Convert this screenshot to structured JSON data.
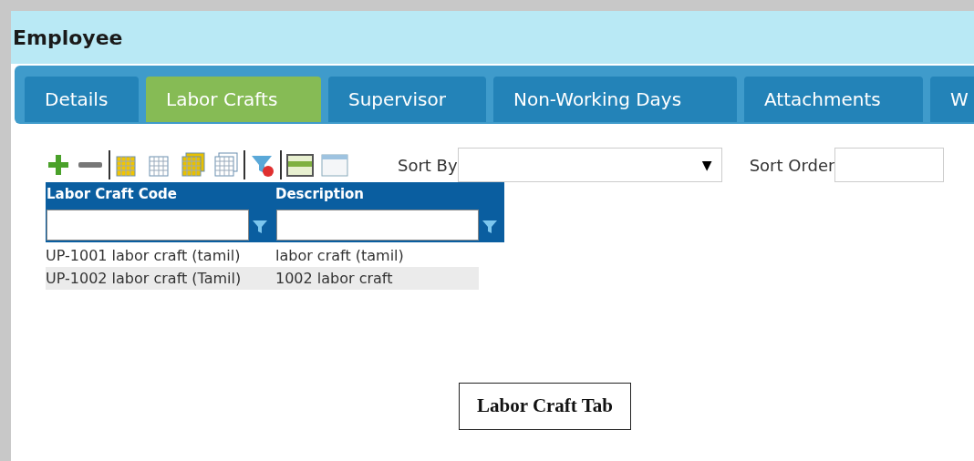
{
  "window": {
    "title": "Employee"
  },
  "tabs": [
    {
      "label": "Details",
      "selected": false
    },
    {
      "label": "Labor Crafts",
      "selected": true
    },
    {
      "label": "Supervisor",
      "selected": false
    },
    {
      "label": "Non-Working Days",
      "selected": false
    },
    {
      "label": "Attachments",
      "selected": false
    },
    {
      "label": "W",
      "selected": false
    }
  ],
  "sort": {
    "sort_by_label": "Sort By",
    "sort_by_arrow": "▼",
    "sort_order_label": "Sort Order"
  },
  "table": {
    "columns": [
      "Labor Craft Code",
      "Description"
    ],
    "rows": [
      {
        "cells": [
          "UP-1001 labor craft (tamil)",
          "labor craft (tamil)"
        ],
        "selected": false
      },
      {
        "cells": [
          "UP-1002 labor craft (Tamil)",
          "1002 labor craft"
        ],
        "selected": true
      }
    ]
  },
  "caption": "Labor Craft Tab"
}
